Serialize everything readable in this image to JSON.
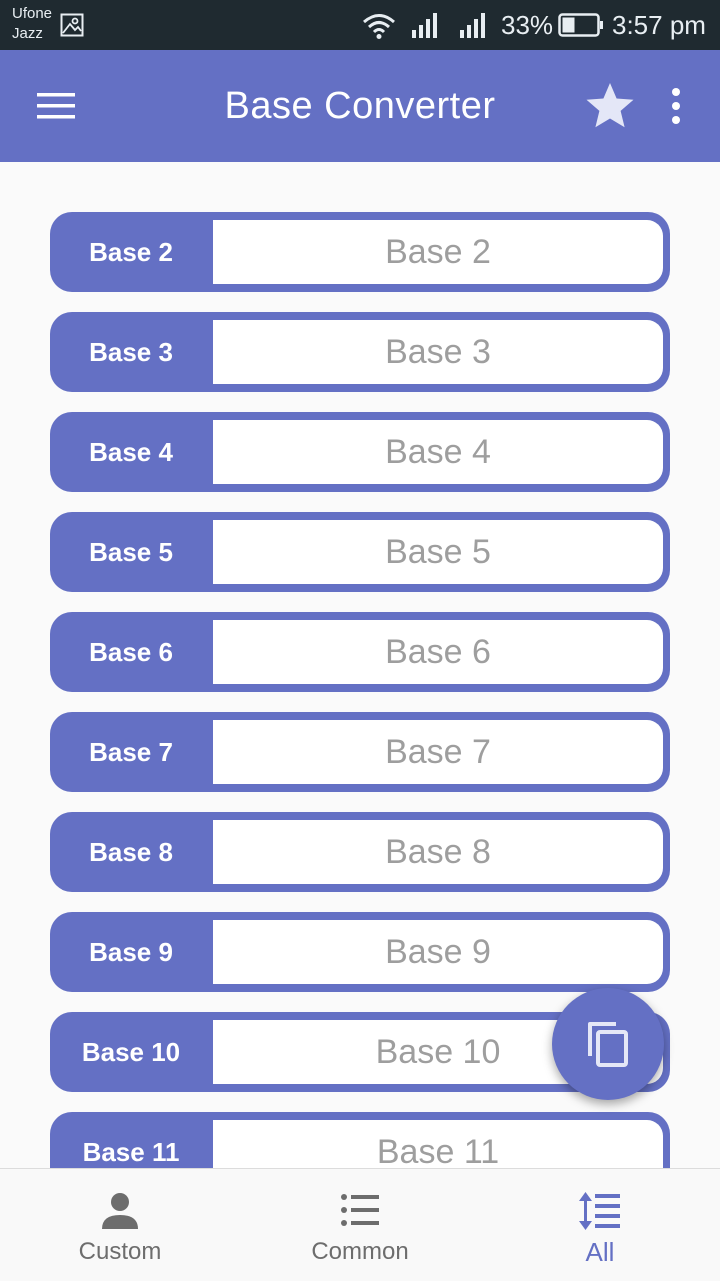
{
  "status_bar": {
    "carrier_line1": "Ufone",
    "carrier_line2": "Jazz",
    "battery_percent": "33%",
    "time": "3:57 pm"
  },
  "app_bar": {
    "title": "Base Converter"
  },
  "bases": [
    {
      "label": "Base 2",
      "placeholder": "Base 2"
    },
    {
      "label": "Base 3",
      "placeholder": "Base 3"
    },
    {
      "label": "Base 4",
      "placeholder": "Base 4"
    },
    {
      "label": "Base 5",
      "placeholder": "Base 5"
    },
    {
      "label": "Base 6",
      "placeholder": "Base 6"
    },
    {
      "label": "Base 7",
      "placeholder": "Base 7"
    },
    {
      "label": "Base 8",
      "placeholder": "Base 8"
    },
    {
      "label": "Base 9",
      "placeholder": "Base 9"
    },
    {
      "label": "Base 10",
      "placeholder": "Base 10"
    },
    {
      "label": "Base 11",
      "placeholder": "Base 11"
    }
  ],
  "bottom_nav": {
    "items": [
      {
        "label": "Custom",
        "icon": "person-icon"
      },
      {
        "label": "Common",
        "icon": "list-icon"
      },
      {
        "label": "All",
        "icon": "sort-icon"
      }
    ],
    "active": "All"
  },
  "colors": {
    "primary": "#6470c4",
    "status_bar": "#1f2a30",
    "placeholder_text": "#9e9e9e"
  }
}
